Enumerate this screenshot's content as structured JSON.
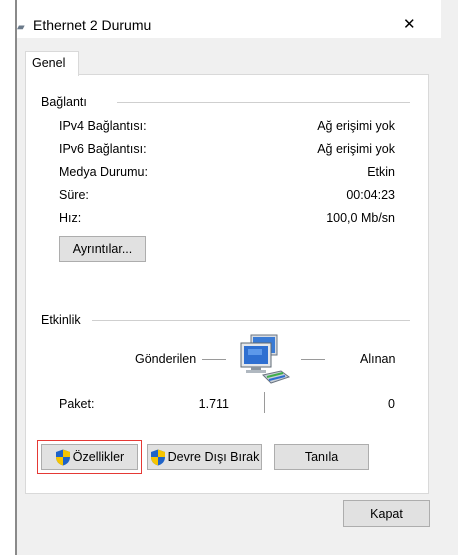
{
  "window": {
    "title": "Ethernet 2 Durumu",
    "close_glyph": "✕",
    "title_icon": "network-adapter-icon"
  },
  "tabs": [
    {
      "label": "Genel"
    }
  ],
  "connection": {
    "section_title": "Bağlantı",
    "rows": [
      {
        "label": "IPv4 Bağlantısı:",
        "value": "Ağ erişimi yok"
      },
      {
        "label": "IPv6 Bağlantısı:",
        "value": "Ağ erişimi yok"
      },
      {
        "label": "Medya Durumu:",
        "value": "Etkin"
      },
      {
        "label": "Süre:",
        "value": "00:04:23"
      },
      {
        "label": "Hız:",
        "value": "100,0 Mb/sn"
      }
    ],
    "details_button": "Ayrıntılar..."
  },
  "activity": {
    "section_title": "Etkinlik",
    "sent_label": "Gönderilen",
    "received_label": "Alınan",
    "packets_label": "Paket:",
    "packets_sent": "1.711",
    "packets_received": "0",
    "icon": "network-computers-icon"
  },
  "buttons": {
    "properties": "Özellikler",
    "disable": "Devre Dışı Bırak",
    "diagnose": "Tanıla",
    "close": "Kapat"
  },
  "colors": {
    "highlight": "#e53935",
    "shield_blue": "#1e63c8",
    "shield_yellow": "#f5c400"
  }
}
